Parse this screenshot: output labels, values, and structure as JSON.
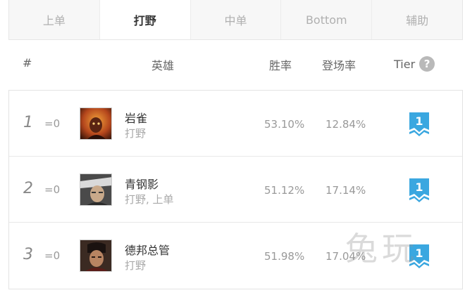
{
  "tabs": [
    {
      "label": "上单",
      "active": false
    },
    {
      "label": "打野",
      "active": true
    },
    {
      "label": "中单",
      "active": false
    },
    {
      "label": "Bottom",
      "active": false
    },
    {
      "label": "辅助",
      "active": false
    }
  ],
  "header": {
    "num": "#",
    "hero": "英雄",
    "winrate": "胜率",
    "pickrate": "登场率",
    "tier": "Tier",
    "help": "?"
  },
  "rows": [
    {
      "rank": "1",
      "delta": "=0",
      "name": "岩雀",
      "role": "打野",
      "winrate": "53.10%",
      "pickrate": "12.84%",
      "tier": "1"
    },
    {
      "rank": "2",
      "delta": "=0",
      "name": "青钢影",
      "role": "打野, 上单",
      "winrate": "51.12%",
      "pickrate": "17.14%",
      "tier": "1"
    },
    {
      "rank": "3",
      "delta": "=0",
      "name": "德邦总管",
      "role": "打野",
      "winrate": "51.98%",
      "pickrate": "17.04%",
      "tier": "1"
    }
  ],
  "watermark": "兔玩",
  "colors": {
    "tier_badge": "#3aa7e0",
    "active_tab_text": "#333333"
  }
}
